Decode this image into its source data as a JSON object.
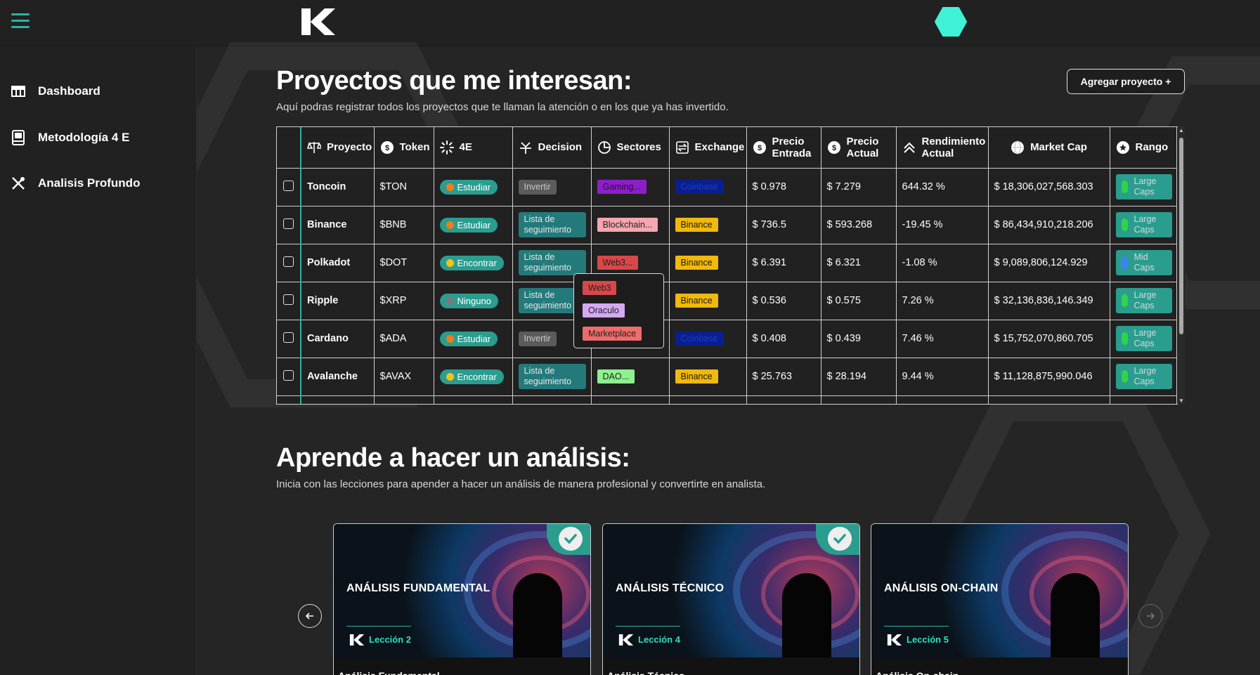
{
  "sidebar": {
    "items": [
      {
        "label": "Dashboard",
        "icon": "table-icon"
      },
      {
        "label": "Metodología 4 E",
        "icon": "book-icon"
      },
      {
        "label": "Analisis Profundo",
        "icon": "tools-icon"
      }
    ]
  },
  "projects": {
    "title": "Proyectos que me interesan:",
    "subtitle": "Aquí podras registrar todos los proyectos que te llaman la atención o en los que ya has invertido.",
    "add_label": "Agregar proyecto +",
    "headers": [
      "Proyecto",
      "Token",
      "4E",
      "Decision",
      "Sectores",
      "Exchange",
      "Precio Entrada",
      "Precio Actual",
      "Rendimiento Actual",
      "Market Cap",
      "Rango"
    ],
    "rows": [
      {
        "name": "Toncoin",
        "token": "$TON",
        "e4": "Estudiar",
        "decision": "Invertir",
        "sector": "Gaming...",
        "exchange": "Coinbase",
        "entrada": "$ 0.978",
        "actual": "$ 7.279",
        "rend": "644.32 %",
        "mcap": "$ 18,306,027,568.303",
        "rango": "Large Caps"
      },
      {
        "name": "Binance",
        "token": "$BNB",
        "e4": "Estudiar",
        "decision": "Lista de seguimiento",
        "sector": "Blockchain...",
        "exchange": "Binance",
        "entrada": "$ 736.5",
        "actual": "$ 593.268",
        "rend": "-19.45 %",
        "mcap": "$ 86,434,910,218.206",
        "rango": "Large Caps"
      },
      {
        "name": "Polkadot",
        "token": "$DOT",
        "e4": "Encontrar",
        "decision": "Lista de seguimiento",
        "sector": "Web3...",
        "exchange": "Binance",
        "entrada": "$ 6.391",
        "actual": "$ 6.321",
        "rend": "-1.08 %",
        "mcap": "$ 9,089,806,124.929",
        "rango": "Mid Caps"
      },
      {
        "name": "Ripple",
        "token": "$XRP",
        "e4": "Ninguno",
        "decision": "Lista de seguimiento",
        "sector": "",
        "exchange": "Binance",
        "entrada": "$ 0.536",
        "actual": "$ 0.575",
        "rend": "7.26 %",
        "mcap": "$ 32,136,836,146.349",
        "rango": "Large Caps"
      },
      {
        "name": "Cardano",
        "token": "$ADA",
        "e4": "Estudiar",
        "decision": "Invertir",
        "sector": "",
        "exchange": "Coinbase",
        "entrada": "$ 0.408",
        "actual": "$ 0.439",
        "rend": "7.46 %",
        "mcap": "$ 15,752,070,860.705",
        "rango": "Large Caps"
      },
      {
        "name": "Avalanche",
        "token": "$AVAX",
        "e4": "Encontrar",
        "decision": "Lista de seguimiento",
        "sector": "DAO...",
        "exchange": "Binance",
        "entrada": "$ 25.763",
        "actual": "$ 28.194",
        "rend": "9.44 %",
        "mcap": "$ 11,128,875,990.046",
        "rango": "Large Caps"
      }
    ],
    "popup_tags": [
      "Web3",
      "Oraculo",
      "Marketplace"
    ]
  },
  "colors": {
    "accent": "#2bb3a0",
    "estudiar": "#f07d1a",
    "encontrar": "#f0c419",
    "ninguno": "#7a7a7a",
    "large_caps": "#2ed44a",
    "mid_caps": "#3b82f6",
    "binance": "#f0b90b",
    "coinbase": "#0a1f8f",
    "gaming": "#8d1fc7",
    "blockchain": "#f4a7b0",
    "web3": "#d94848",
    "oraculo": "#d5a9f2",
    "marketplace": "#f06b6b",
    "dao": "#8ef08e"
  },
  "learn": {
    "title": "Aprende a hacer un análisis:",
    "subtitle": "Inicia con las lecciones para apender a hacer un análisis de manera profesional y convertirte en analista.",
    "cards": [
      {
        "title": "ANÁLISIS FUNDAMENTAL",
        "lesson": "Lección 2",
        "footer": "Análisis Fundamental",
        "done": true
      },
      {
        "title": "ANÁLISIS TÉCNICO",
        "lesson": "Lección 4",
        "footer": "Análisis Técnico",
        "done": true
      },
      {
        "title": "ANÁLISIS ON-CHAIN",
        "lesson": "Lección 5",
        "footer": "Análisis On-chain",
        "done": false
      }
    ]
  }
}
